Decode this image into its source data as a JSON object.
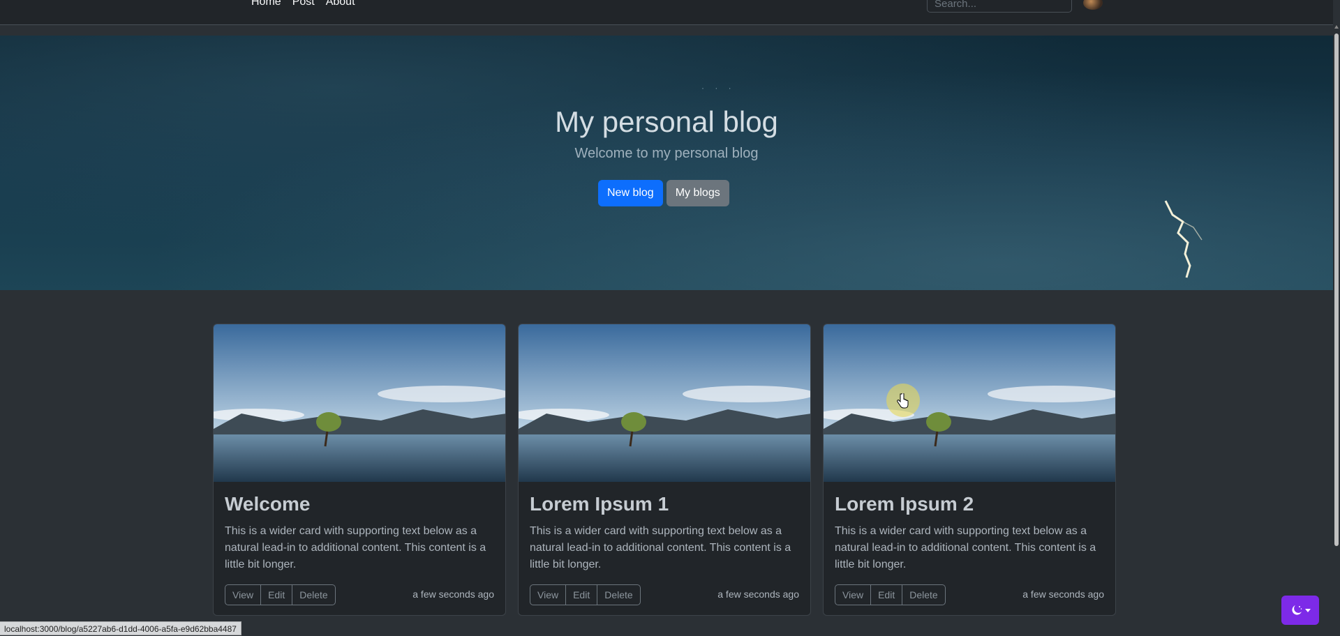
{
  "nav": {
    "links": [
      "Home",
      "Post",
      "About"
    ],
    "search_placeholder": "Search..."
  },
  "hero": {
    "title": "My personal blog",
    "subtitle": "Welcome to my personal blog",
    "new_blog_label": "New blog",
    "my_blogs_label": "My blogs"
  },
  "cards": [
    {
      "title": "Welcome",
      "text": "This is a wider card with supporting text below as a natural lead-in to additional content. This content is a little bit longer.",
      "view_label": "View",
      "edit_label": "Edit",
      "delete_label": "Delete",
      "time": "a few seconds ago"
    },
    {
      "title": "Lorem Ipsum 1",
      "text": "This is a wider card with supporting text below as a natural lead-in to additional content. This content is a little bit longer.",
      "view_label": "View",
      "edit_label": "Edit",
      "delete_label": "Delete",
      "time": "a few seconds ago"
    },
    {
      "title": "Lorem Ipsum 2",
      "text": "This is a wider card with supporting text below as a natural lead-in to additional content. This content is a little bit longer.",
      "view_label": "View",
      "edit_label": "Edit",
      "delete_label": "Delete",
      "time": "a few seconds ago"
    }
  ],
  "status_bar": {
    "url": "localhost:3000/blog/a5227ab6-d1dd-4006-a5fa-e9d62bba4487"
  },
  "theme_toggle": {
    "icon": "moon-stars-icon",
    "accent_color": "#7d2ae8"
  },
  "colors": {
    "primary": "#0d6efd",
    "secondary": "#6c757d",
    "background": "#2b3035",
    "card": "#212529"
  }
}
